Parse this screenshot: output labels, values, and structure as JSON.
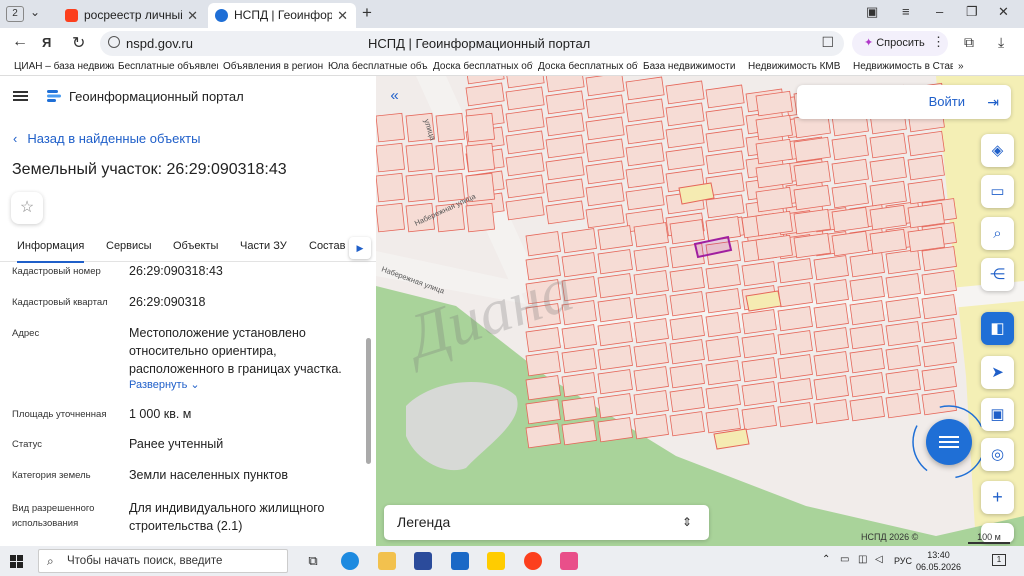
{
  "browser": {
    "tab_count": "2",
    "tabs": [
      {
        "title": "росреестр личный кабинет",
        "favicon_color": "#fc3f1d"
      },
      {
        "title": "НСПД | Геоинформационный портал",
        "favicon_color": "#1f6fd6"
      }
    ],
    "url_host": "nspd.gov.ru",
    "page_title": "НСПД | Геоинформационный портал",
    "ask_button": "Спросить",
    "bookmarks": [
      "ЦИАН – база недвижимости",
      "Бесплатные объявления",
      "Объявления в регионе",
      "Юла бесплатные объявления",
      "Доска бесплатных объявлений",
      "Доска бесплатных объявлений",
      "База недвижимости",
      "Недвижимость КМВ",
      "Недвижимость в Ставрополе"
    ]
  },
  "portal": {
    "name": "Геоинформационный портал",
    "back_link": "Назад в найденные объекты",
    "object_title": "Земельный участок: 26:29:090318:43",
    "tabs": [
      "Информация",
      "Сервисы",
      "Объекты",
      "Части ЗУ",
      "Состав"
    ],
    "active_tab": "Информация",
    "fields": [
      {
        "label": "Кадастровый номер",
        "value": "26:29:090318:43"
      },
      {
        "label": "Кадастровый квартал",
        "value": "26:29:090318"
      },
      {
        "label": "Адрес",
        "value": "Местоположение установлено относительно ориентира, расположенного в границах участка."
      },
      {
        "label": "Площадь уточненная",
        "value": "1 000 кв. м"
      },
      {
        "label": "Статус",
        "value": "Ранее учтенный"
      },
      {
        "label": "Категория земель",
        "value": "Земли населенных пунктов"
      },
      {
        "label": "Вид разрешенного использования",
        "value": "Для индивидуального жилищного строительства (2.1)"
      }
    ],
    "expand_label": "Развернуть"
  },
  "map": {
    "login_label": "Войти",
    "legend_label": "Легенда",
    "copyright": "НСПД 2026 ©",
    "scale_label": "100 м",
    "street_labels": [
      "улица",
      "Набережная улица",
      "Набережная улица"
    ],
    "watermark": "Диана",
    "accent_color": "#1f5fc9",
    "selected_parcel_color": "#a01fa0",
    "parcel_line_color": "#e5675a",
    "buttons": [
      "collapse-panel",
      "layers",
      "ruler",
      "search-area",
      "share",
      "nspd-logo",
      "locate",
      "print",
      "measure",
      "zoom-in"
    ]
  },
  "taskbar": {
    "search_placeholder": "Чтобы начать поиск, введите",
    "language": "РУС",
    "time": "13:40",
    "date": "06.05.2026",
    "notifications": "1"
  }
}
